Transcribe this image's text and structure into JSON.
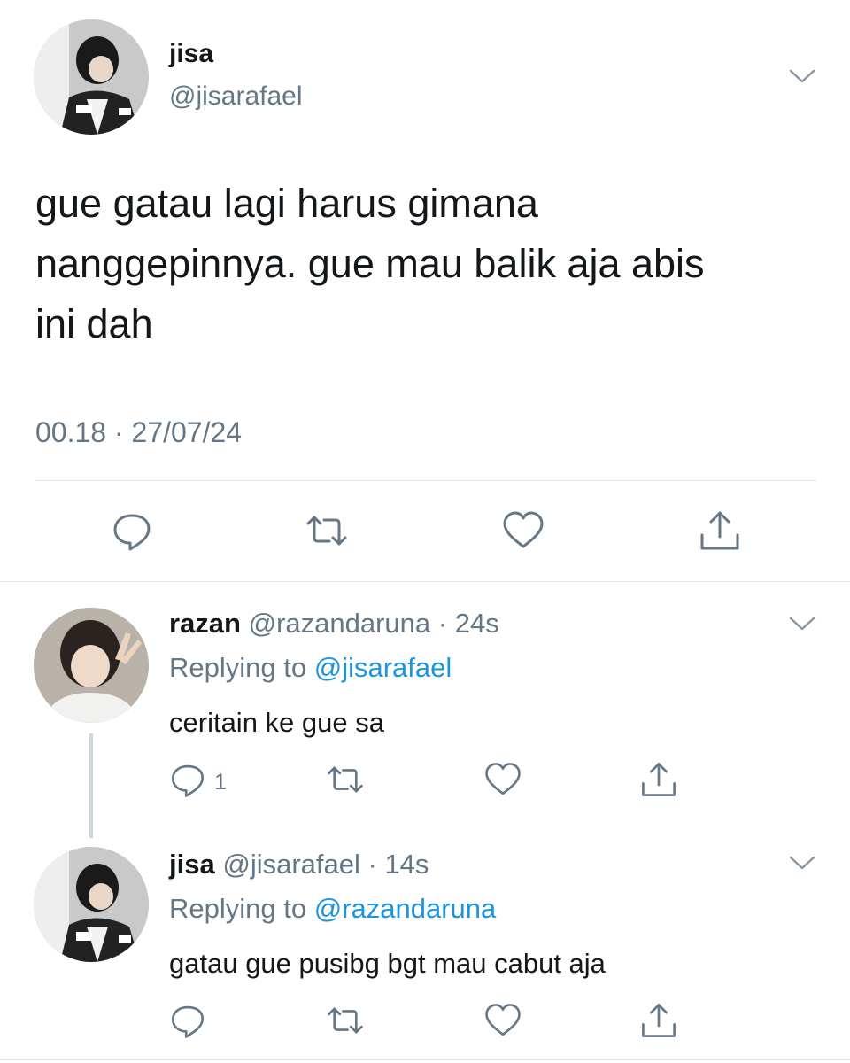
{
  "main_tweet": {
    "name": "jisa",
    "handle": "@jisarafael",
    "text_lines": [
      "gue gatau lagi harus gimana",
      "nanggepinnya. gue mau balik aja abis",
      "ini dah"
    ],
    "timestamp": "00.18 · 27/07/24",
    "actions": [
      "reply-icon",
      "retweet-icon",
      "like-icon",
      "share-icon"
    ]
  },
  "replies": [
    {
      "name": "razan",
      "handle": "@razandaruna",
      "time": "24s",
      "replying_label": "Replying to ",
      "replying_handle": "@jisarafael",
      "text": "ceritain ke gue sa",
      "reply_count": "1"
    },
    {
      "name": "jisa",
      "handle": "@jisarafael",
      "time": "14s",
      "replying_label": "Replying to ",
      "replying_handle": "@razandaruna",
      "text": "gatau gue pusibg bgt mau cabut aja",
      "reply_count": ""
    }
  ],
  "colors": {
    "text": "#14171a",
    "muted": "#657786",
    "link": "#1b95e0",
    "divider": "#e1e8ed"
  }
}
